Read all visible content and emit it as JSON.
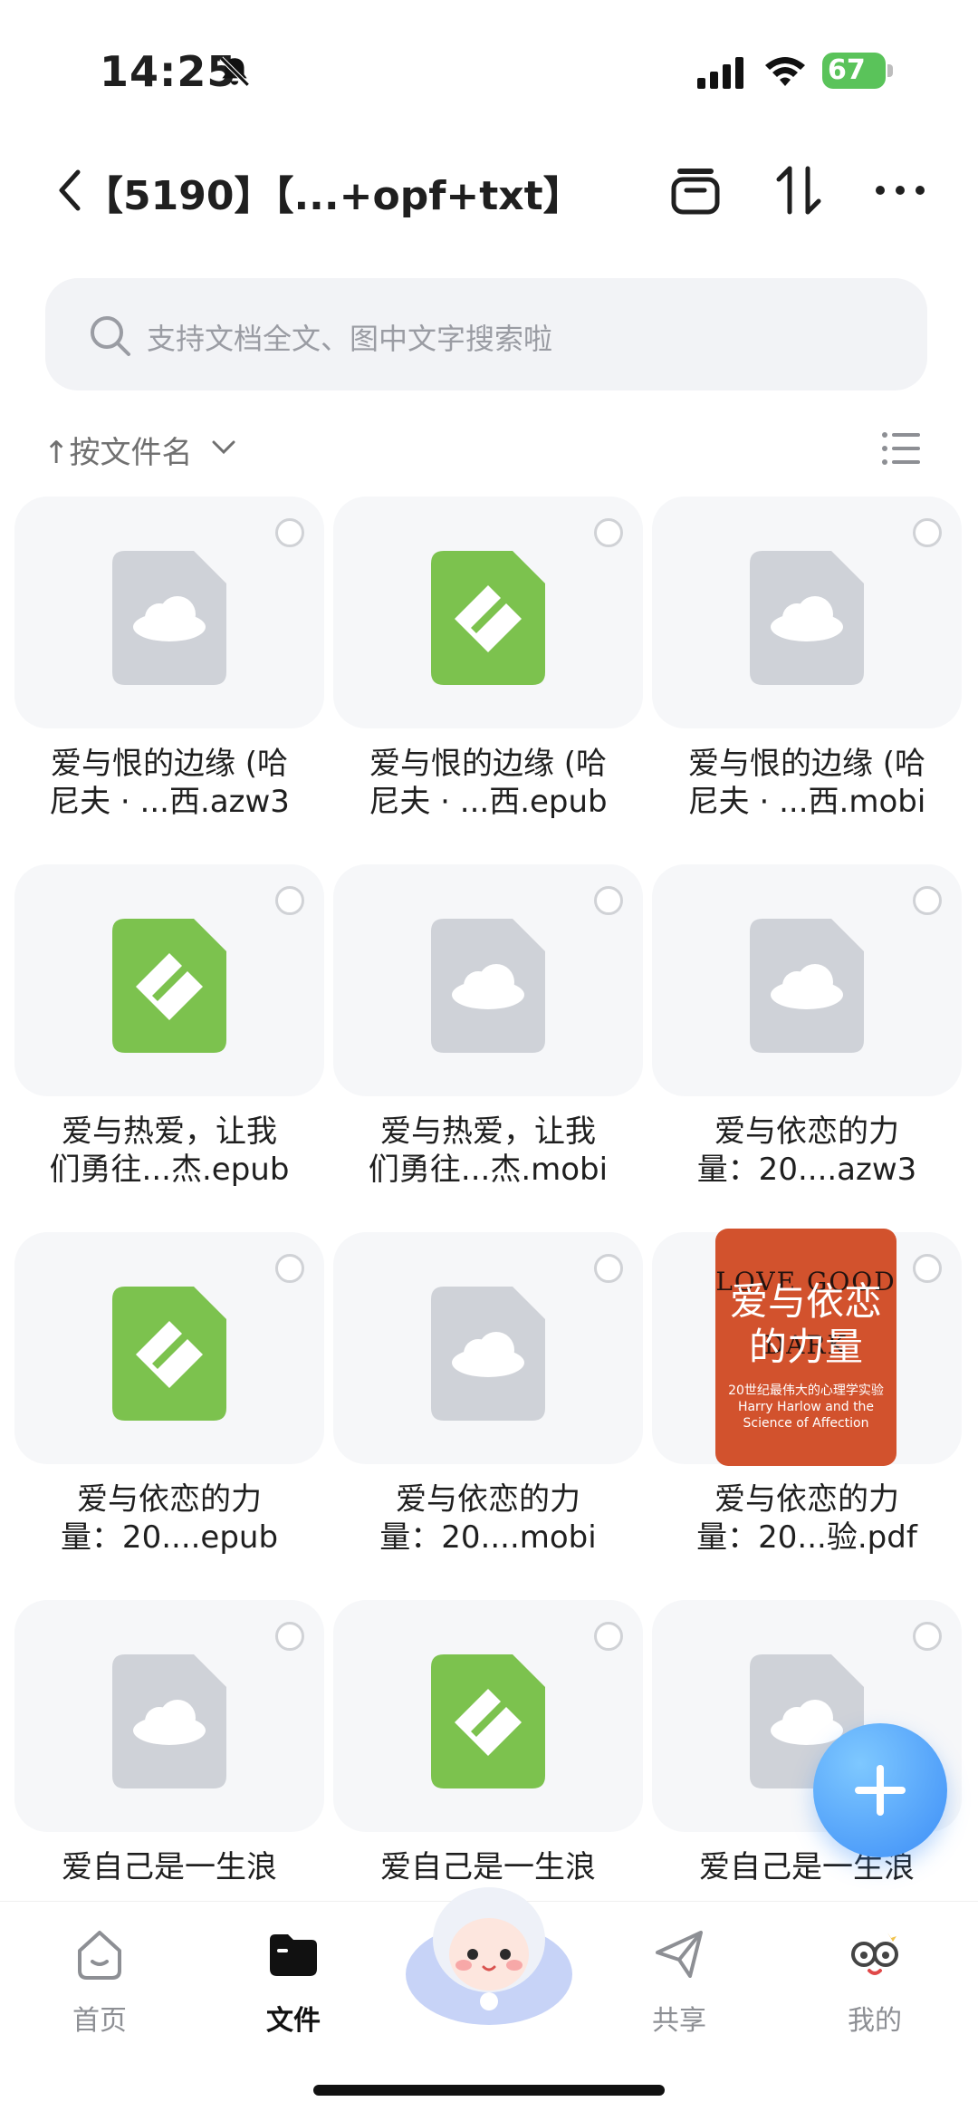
{
  "status_bar": {
    "time": "14:25",
    "battery": "67",
    "icons": [
      "bell-muted-icon",
      "signal-icon",
      "wifi-icon",
      "battery-charging-icon"
    ]
  },
  "header": {
    "title": "【5190】【...+opf+txt】",
    "icons": [
      "back-icon",
      "archive-icon",
      "sort-arrows-icon",
      "more-icon"
    ]
  },
  "search": {
    "placeholder": "支持文档全文、图中文字搜索啦"
  },
  "sort": {
    "label": "↑按文件名"
  },
  "files": [
    {
      "name_line1": "爱与恨的边缘 (哈",
      "name_line2": "尼夫 · ...西.azw3",
      "icon": "cloud-file-icon"
    },
    {
      "name_line1": "爱与恨的边缘 (哈",
      "name_line2": "尼夫 · ...西.epub",
      "icon": "epub-file-icon"
    },
    {
      "name_line1": "爱与恨的边缘 (哈",
      "name_line2": "尼夫 · ...西.mobi",
      "icon": "cloud-file-icon"
    },
    {
      "name_line1": "爱与热爱，让我",
      "name_line2": "们勇往...杰.epub",
      "icon": "epub-file-icon"
    },
    {
      "name_line1": "爱与热爱，让我",
      "name_line2": "们勇往...杰.mobi",
      "icon": "cloud-file-icon"
    },
    {
      "name_line1": "爱与依恋的力",
      "name_line2": "量：20....azw3",
      "icon": "cloud-file-icon"
    },
    {
      "name_line1": "爱与依恋的力",
      "name_line2": "量：20....epub",
      "icon": "epub-file-icon"
    },
    {
      "name_line1": "爱与依恋的力",
      "name_line2": "量：20....mobi",
      "icon": "cloud-file-icon"
    },
    {
      "name_line1": "爱与依恋的力",
      "name_line2": "量：20...验.pdf",
      "icon": "book-cover-thumbnail"
    },
    {
      "name_line1": "爱自己是一生浪",
      "name_line2": "",
      "icon": "cloud-file-icon"
    },
    {
      "name_line1": "爱自己是一生浪",
      "name_line2": "",
      "icon": "epub-file-icon"
    },
    {
      "name_line1": "爱自己是一生浪",
      "name_line2": "",
      "icon": "cloud-file-icon"
    }
  ],
  "cover": {
    "title_cn": "爱与依恋的力量",
    "title_en": "LOVE GOOD DARK",
    "subtitle": "20世纪最伟大的心理学实验 Harry Harlow and the Science of Affection"
  },
  "tabbar": {
    "tabs": [
      {
        "label": "首页",
        "icon": "home-icon"
      },
      {
        "label": "文件",
        "icon": "folder-icon",
        "active": true
      },
      {
        "label": "",
        "icon": "mascot-icon"
      },
      {
        "label": "共享",
        "icon": "share-icon"
      },
      {
        "label": "我的",
        "icon": "profile-icon"
      }
    ]
  },
  "colors": {
    "accent": "#3d8ef7",
    "epub_green": "#7cc24e",
    "cloud_gray": "#cfd2d8",
    "cover_red": "#d2522d"
  }
}
